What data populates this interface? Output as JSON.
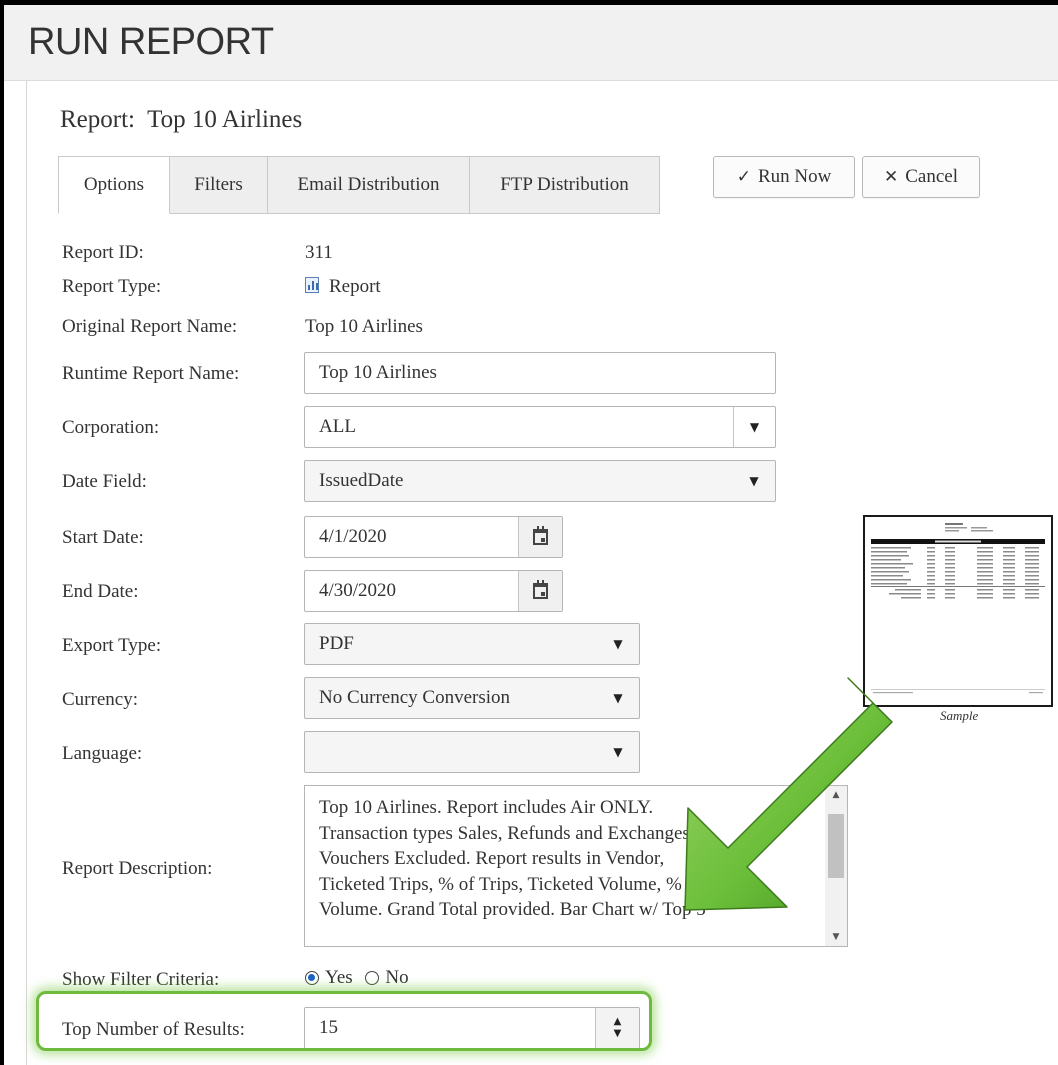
{
  "page": {
    "title": "RUN REPORT"
  },
  "report": {
    "heading_prefix": "Report:",
    "heading_name": "Top 10 Airlines"
  },
  "tabs": [
    {
      "label": "Options",
      "active": true
    },
    {
      "label": "Filters",
      "active": false
    },
    {
      "label": "Email Distribution",
      "active": false
    },
    {
      "label": "FTP Distribution",
      "active": false
    }
  ],
  "actions": {
    "run_now": "Run Now",
    "cancel": "Cancel"
  },
  "fields": {
    "report_id": {
      "label": "Report ID:",
      "value": "311"
    },
    "report_type": {
      "label": "Report Type:",
      "value": "Report",
      "icon": "bar-chart-report-icon"
    },
    "original_report_name": {
      "label": "Original Report Name:",
      "value": "Top 10 Airlines"
    },
    "runtime_report_name": {
      "label": "Runtime Report Name:",
      "value": "Top 10 Airlines"
    },
    "corporation": {
      "label": "Corporation:",
      "value": "ALL"
    },
    "date_field": {
      "label": "Date Field:",
      "value": "IssuedDate"
    },
    "start_date": {
      "label": "Start Date:",
      "value": "4/1/2020"
    },
    "end_date": {
      "label": "End Date:",
      "value": "4/30/2020"
    },
    "export_type": {
      "label": "Export Type:",
      "value": "PDF"
    },
    "currency": {
      "label": "Currency:",
      "value": "No Currency Conversion"
    },
    "language": {
      "label": "Language:",
      "value": ""
    },
    "report_description": {
      "label": "Report Description:",
      "lines": [
        "Top 10 Airlines.  Report includes Air ONLY.",
        "Transaction types Sales, Refunds and Exchanges.",
        "Vouchers Excluded.  Report results in Vendor,",
        "Ticketed Trips, % of Trips, Ticketed Volume, % of",
        "Volume.  Grand Total provided.  Bar Chart w/ Top 5"
      ]
    },
    "show_filter_criteria": {
      "label": "Show Filter Criteria:",
      "options": [
        "Yes",
        "No"
      ],
      "selected": "Yes"
    },
    "top_number_of_results": {
      "label": "Top Number of Results:",
      "value": "15"
    }
  },
  "sample": {
    "caption": "Sample"
  },
  "annotation": {
    "arrow_color": "#5fae2e",
    "highlight_color": "#6dba3c"
  }
}
